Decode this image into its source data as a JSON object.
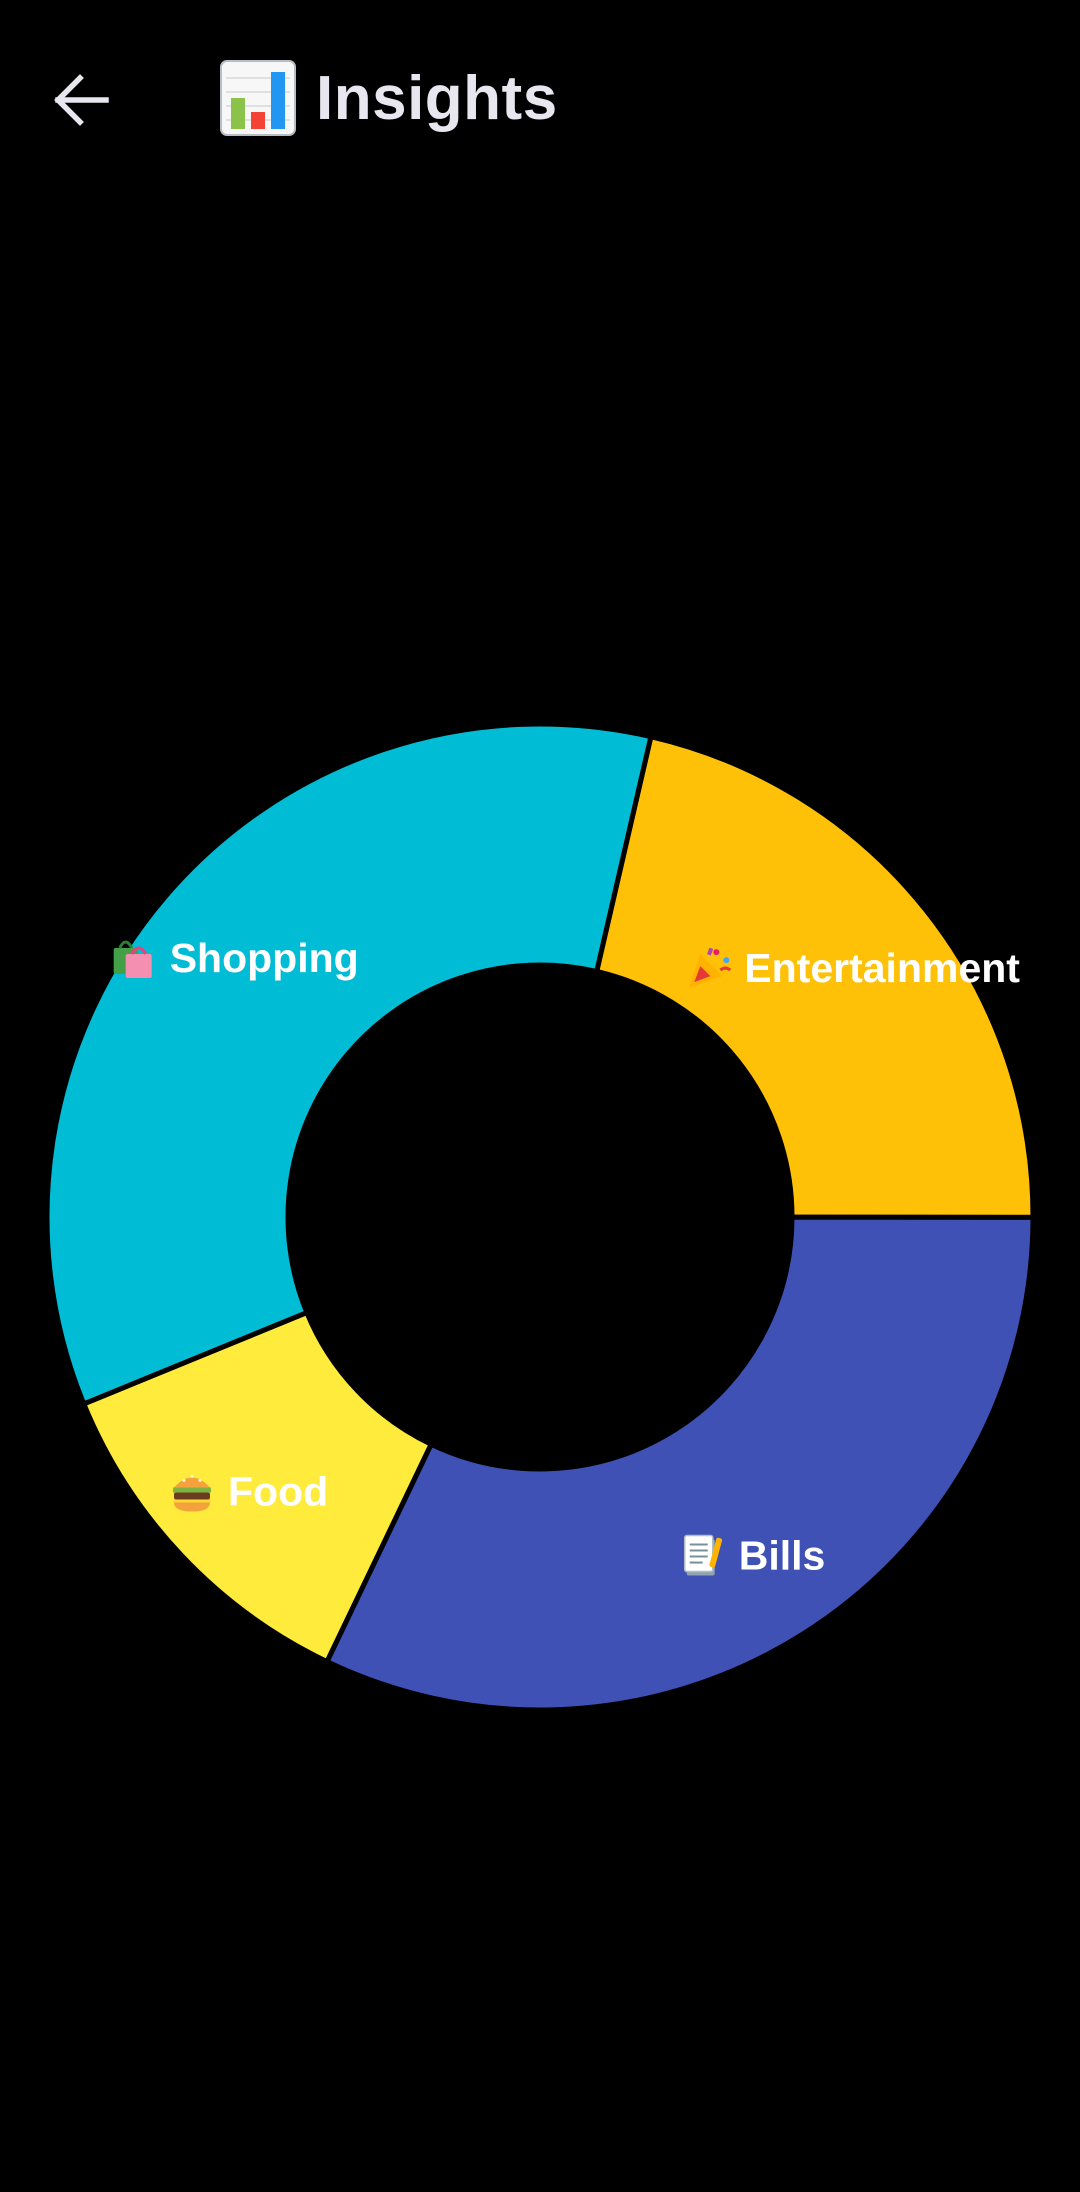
{
  "app_bar": {
    "back_icon": "arrow-left-icon",
    "title_icon": "bar-chart-emoji-icon",
    "title": "Insights"
  },
  "chart_data": {
    "type": "pie",
    "style": "donut",
    "title": "",
    "legend": "none",
    "slices": [
      {
        "label": "Entertainment",
        "icon": "party-popper-emoji-icon",
        "value": 21.4,
        "color": "#FFC107"
      },
      {
        "label": "Bills",
        "icon": "memo-emoji-icon",
        "value": 32.1,
        "color": "#3F51B5"
      },
      {
        "label": "Food",
        "icon": "burger-emoji-icon",
        "value": 11.7,
        "color": "#FFEB3B"
      },
      {
        "label": "Shopping",
        "icon": "shopping-bags-emoji-icon",
        "value": 34.8,
        "color": "#00BCD4"
      }
    ],
    "start_angle_deg": -77,
    "direction": "clockwise"
  },
  "colors": {
    "background": "#000000",
    "text": "#E8E6EE",
    "separator": "#000000"
  }
}
